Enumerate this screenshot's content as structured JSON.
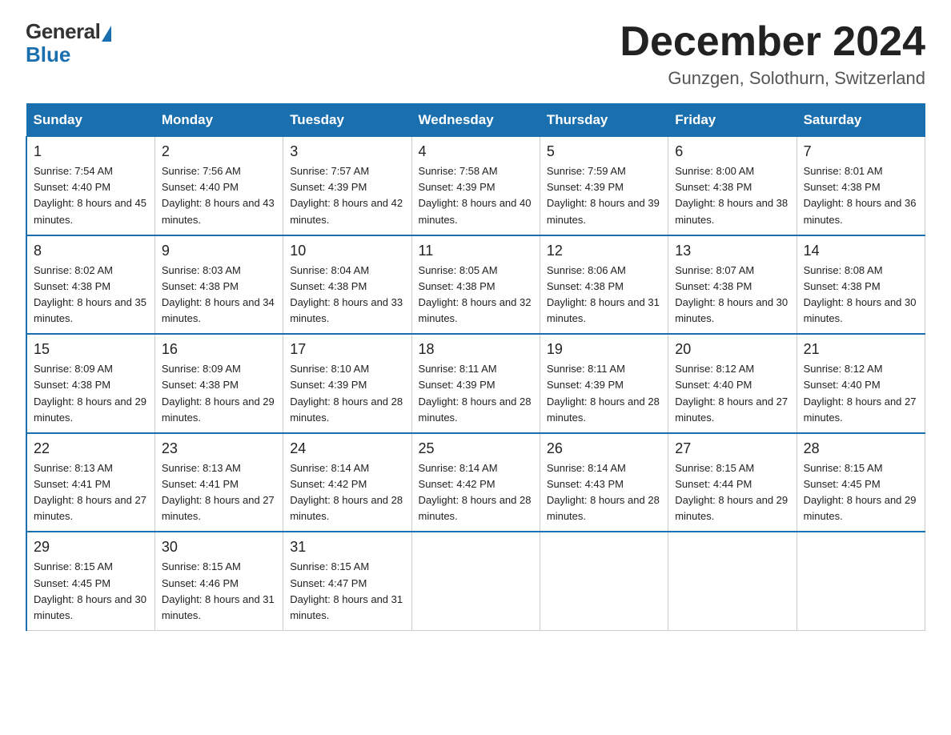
{
  "header": {
    "logo_general": "General",
    "logo_blue": "Blue",
    "month_title": "December 2024",
    "location": "Gunzgen, Solothurn, Switzerland"
  },
  "weekdays": [
    "Sunday",
    "Monday",
    "Tuesday",
    "Wednesday",
    "Thursday",
    "Friday",
    "Saturday"
  ],
  "weeks": [
    [
      {
        "day": "1",
        "sunrise": "Sunrise: 7:54 AM",
        "sunset": "Sunset: 4:40 PM",
        "daylight": "Daylight: 8 hours and 45 minutes."
      },
      {
        "day": "2",
        "sunrise": "Sunrise: 7:56 AM",
        "sunset": "Sunset: 4:40 PM",
        "daylight": "Daylight: 8 hours and 43 minutes."
      },
      {
        "day": "3",
        "sunrise": "Sunrise: 7:57 AM",
        "sunset": "Sunset: 4:39 PM",
        "daylight": "Daylight: 8 hours and 42 minutes."
      },
      {
        "day": "4",
        "sunrise": "Sunrise: 7:58 AM",
        "sunset": "Sunset: 4:39 PM",
        "daylight": "Daylight: 8 hours and 40 minutes."
      },
      {
        "day": "5",
        "sunrise": "Sunrise: 7:59 AM",
        "sunset": "Sunset: 4:39 PM",
        "daylight": "Daylight: 8 hours and 39 minutes."
      },
      {
        "day": "6",
        "sunrise": "Sunrise: 8:00 AM",
        "sunset": "Sunset: 4:38 PM",
        "daylight": "Daylight: 8 hours and 38 minutes."
      },
      {
        "day": "7",
        "sunrise": "Sunrise: 8:01 AM",
        "sunset": "Sunset: 4:38 PM",
        "daylight": "Daylight: 8 hours and 36 minutes."
      }
    ],
    [
      {
        "day": "8",
        "sunrise": "Sunrise: 8:02 AM",
        "sunset": "Sunset: 4:38 PM",
        "daylight": "Daylight: 8 hours and 35 minutes."
      },
      {
        "day": "9",
        "sunrise": "Sunrise: 8:03 AM",
        "sunset": "Sunset: 4:38 PM",
        "daylight": "Daylight: 8 hours and 34 minutes."
      },
      {
        "day": "10",
        "sunrise": "Sunrise: 8:04 AM",
        "sunset": "Sunset: 4:38 PM",
        "daylight": "Daylight: 8 hours and 33 minutes."
      },
      {
        "day": "11",
        "sunrise": "Sunrise: 8:05 AM",
        "sunset": "Sunset: 4:38 PM",
        "daylight": "Daylight: 8 hours and 32 minutes."
      },
      {
        "day": "12",
        "sunrise": "Sunrise: 8:06 AM",
        "sunset": "Sunset: 4:38 PM",
        "daylight": "Daylight: 8 hours and 31 minutes."
      },
      {
        "day": "13",
        "sunrise": "Sunrise: 8:07 AM",
        "sunset": "Sunset: 4:38 PM",
        "daylight": "Daylight: 8 hours and 30 minutes."
      },
      {
        "day": "14",
        "sunrise": "Sunrise: 8:08 AM",
        "sunset": "Sunset: 4:38 PM",
        "daylight": "Daylight: 8 hours and 30 minutes."
      }
    ],
    [
      {
        "day": "15",
        "sunrise": "Sunrise: 8:09 AM",
        "sunset": "Sunset: 4:38 PM",
        "daylight": "Daylight: 8 hours and 29 minutes."
      },
      {
        "day": "16",
        "sunrise": "Sunrise: 8:09 AM",
        "sunset": "Sunset: 4:38 PM",
        "daylight": "Daylight: 8 hours and 29 minutes."
      },
      {
        "day": "17",
        "sunrise": "Sunrise: 8:10 AM",
        "sunset": "Sunset: 4:39 PM",
        "daylight": "Daylight: 8 hours and 28 minutes."
      },
      {
        "day": "18",
        "sunrise": "Sunrise: 8:11 AM",
        "sunset": "Sunset: 4:39 PM",
        "daylight": "Daylight: 8 hours and 28 minutes."
      },
      {
        "day": "19",
        "sunrise": "Sunrise: 8:11 AM",
        "sunset": "Sunset: 4:39 PM",
        "daylight": "Daylight: 8 hours and 28 minutes."
      },
      {
        "day": "20",
        "sunrise": "Sunrise: 8:12 AM",
        "sunset": "Sunset: 4:40 PM",
        "daylight": "Daylight: 8 hours and 27 minutes."
      },
      {
        "day": "21",
        "sunrise": "Sunrise: 8:12 AM",
        "sunset": "Sunset: 4:40 PM",
        "daylight": "Daylight: 8 hours and 27 minutes."
      }
    ],
    [
      {
        "day": "22",
        "sunrise": "Sunrise: 8:13 AM",
        "sunset": "Sunset: 4:41 PM",
        "daylight": "Daylight: 8 hours and 27 minutes."
      },
      {
        "day": "23",
        "sunrise": "Sunrise: 8:13 AM",
        "sunset": "Sunset: 4:41 PM",
        "daylight": "Daylight: 8 hours and 27 minutes."
      },
      {
        "day": "24",
        "sunrise": "Sunrise: 8:14 AM",
        "sunset": "Sunset: 4:42 PM",
        "daylight": "Daylight: 8 hours and 28 minutes."
      },
      {
        "day": "25",
        "sunrise": "Sunrise: 8:14 AM",
        "sunset": "Sunset: 4:42 PM",
        "daylight": "Daylight: 8 hours and 28 minutes."
      },
      {
        "day": "26",
        "sunrise": "Sunrise: 8:14 AM",
        "sunset": "Sunset: 4:43 PM",
        "daylight": "Daylight: 8 hours and 28 minutes."
      },
      {
        "day": "27",
        "sunrise": "Sunrise: 8:15 AM",
        "sunset": "Sunset: 4:44 PM",
        "daylight": "Daylight: 8 hours and 29 minutes."
      },
      {
        "day": "28",
        "sunrise": "Sunrise: 8:15 AM",
        "sunset": "Sunset: 4:45 PM",
        "daylight": "Daylight: 8 hours and 29 minutes."
      }
    ],
    [
      {
        "day": "29",
        "sunrise": "Sunrise: 8:15 AM",
        "sunset": "Sunset: 4:45 PM",
        "daylight": "Daylight: 8 hours and 30 minutes."
      },
      {
        "day": "30",
        "sunrise": "Sunrise: 8:15 AM",
        "sunset": "Sunset: 4:46 PM",
        "daylight": "Daylight: 8 hours and 31 minutes."
      },
      {
        "day": "31",
        "sunrise": "Sunrise: 8:15 AM",
        "sunset": "Sunset: 4:47 PM",
        "daylight": "Daylight: 8 hours and 31 minutes."
      },
      null,
      null,
      null,
      null
    ]
  ]
}
